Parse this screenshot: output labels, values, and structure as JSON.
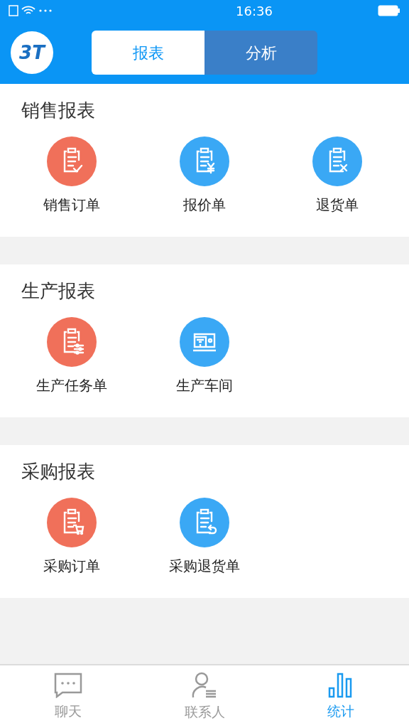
{
  "status_bar": {
    "time": "16:36"
  },
  "header": {
    "logo": "3T",
    "tabs": [
      {
        "label": "报表",
        "selected": true
      },
      {
        "label": "分析",
        "selected": false
      }
    ]
  },
  "sections": [
    {
      "title": "销售报表",
      "items": [
        {
          "label": "销售订单",
          "kind": "check",
          "color": "#f0705a"
        },
        {
          "label": "报价单",
          "kind": "yen",
          "color": "#3aa8f5"
        },
        {
          "label": "退货单",
          "kind": "cross",
          "color": "#3aa8f5"
        }
      ]
    },
    {
      "title": "生产报表",
      "items": [
        {
          "label": "生产任务单",
          "kind": "sliders",
          "color": "#f0705a"
        },
        {
          "label": "生产车间",
          "kind": "machine",
          "color": "#3aa8f5"
        }
      ]
    },
    {
      "title": "采购报表",
      "items": [
        {
          "label": "采购订单",
          "kind": "cart",
          "color": "#f0705a"
        },
        {
          "label": "采购退货单",
          "kind": "return",
          "color": "#3aa8f5"
        }
      ]
    }
  ],
  "bottom_nav": [
    {
      "label": "聊天",
      "kind": "chat",
      "selected": false
    },
    {
      "label": "联系人",
      "kind": "contacts",
      "selected": false
    },
    {
      "label": "统计",
      "kind": "stats",
      "selected": true
    }
  ]
}
